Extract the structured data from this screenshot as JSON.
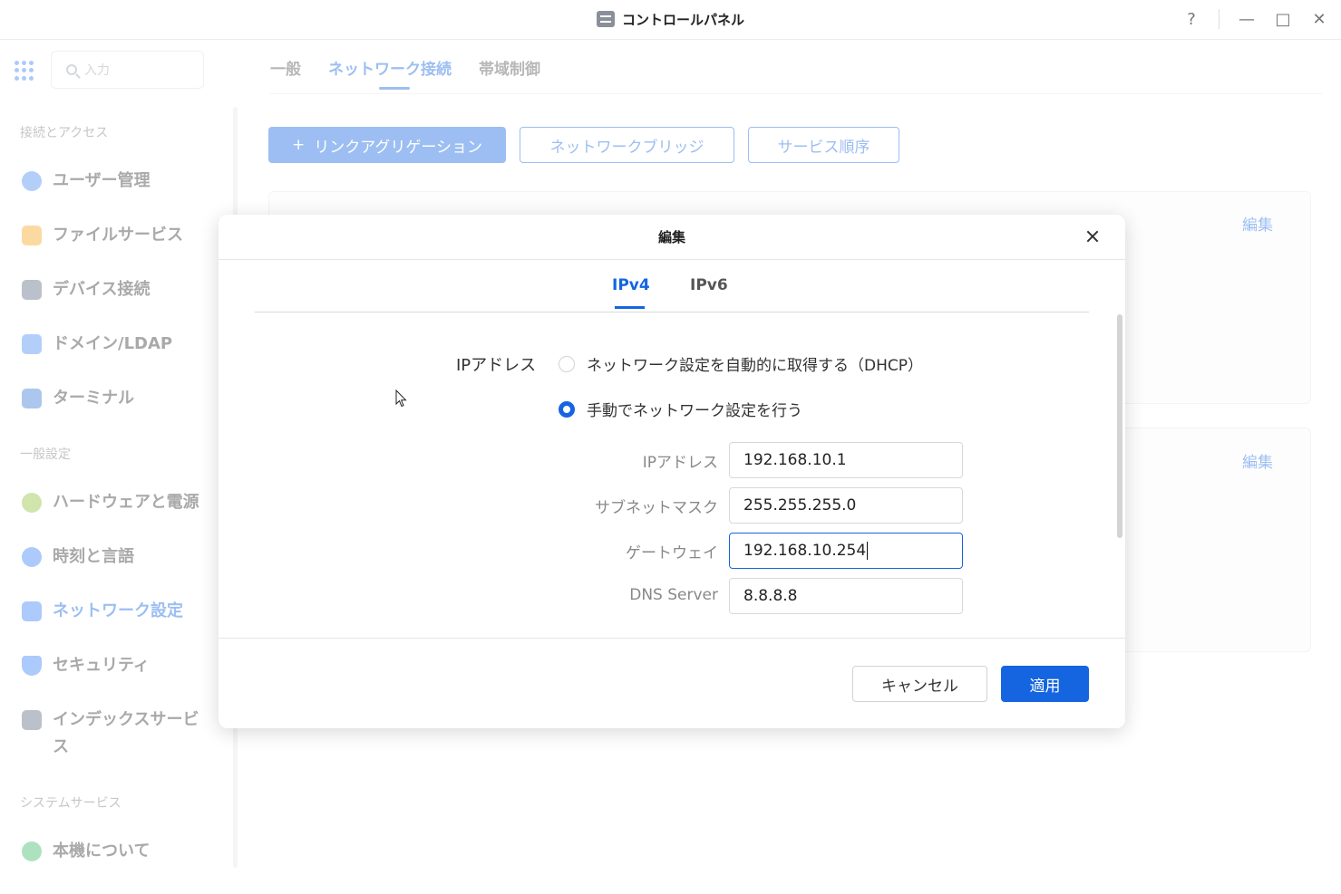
{
  "window": {
    "title": "コントロールパネル",
    "help": "?",
    "minimize": "—",
    "maximize": "□",
    "close": "✕"
  },
  "sidebar": {
    "search_placeholder": "入力",
    "sections": [
      {
        "title": "接続とアクセス"
      },
      {
        "title": "一般設定"
      },
      {
        "title": "システムサービス"
      }
    ],
    "items": [
      {
        "label": "ユーザー管理",
        "icon": "user-icon",
        "color": "#4a8ef0"
      },
      {
        "label": "ファイルサービス",
        "icon": "folder-icon",
        "color": "#f5a623"
      },
      {
        "label": "デバイス接続",
        "icon": "device-icon",
        "color": "#5b6b82"
      },
      {
        "label": "ドメイン/LDAP",
        "icon": "domain-icon",
        "color": "#4a8ef0"
      },
      {
        "label": "ターミナル",
        "icon": "terminal-icon",
        "color": "#3a7bd5"
      },
      {
        "label": "ハードウェアと電源",
        "icon": "hardware-icon",
        "color": "#8fc23f"
      },
      {
        "label": "時刻と言語",
        "icon": "globe-icon",
        "color": "#3b82f6"
      },
      {
        "label": "ネットワーク設定",
        "icon": "network-icon",
        "color": "#3b82f6",
        "active": true
      },
      {
        "label": "セキュリティ",
        "icon": "shield-icon",
        "color": "#3b82f6"
      },
      {
        "label": "インデックスサービス",
        "icon": "index-icon",
        "color": "#5b6b82"
      },
      {
        "label": "本機について",
        "icon": "info-icon",
        "color": "#3dbb6a"
      }
    ]
  },
  "main": {
    "tabs": [
      {
        "label": "一般"
      },
      {
        "label": "ネットワーク接続",
        "active": true
      },
      {
        "label": "帯域制御"
      }
    ],
    "buttons": {
      "link_aggregation": "リンクアグリゲーション",
      "plus": "+",
      "network_bridge": "ネットワークブリッジ",
      "service_order": "サービス順序"
    },
    "cards": [
      {
        "edit": "編集"
      },
      {
        "edit": "編集"
      }
    ]
  },
  "dialog": {
    "title": "編集",
    "tabs": [
      {
        "label": "IPv4",
        "active": true
      },
      {
        "label": "IPv6"
      }
    ],
    "ip_label": "IPアドレス",
    "radio_dhcp": "ネットワーク設定を自動的に取得する（DHCP）",
    "radio_manual": "手動でネットワーク設定を行う",
    "selected": "manual",
    "fields": [
      {
        "label": "IPアドレス",
        "value": "192.168.10.1"
      },
      {
        "label": "サブネットマスク",
        "value": "255.255.255.0"
      },
      {
        "label": "ゲートウェイ",
        "value": "192.168.10.254"
      },
      {
        "label": "DNS Server",
        "value": "8.8.8.8"
      }
    ],
    "cancel": "キャンセル",
    "apply": "適用"
  },
  "colors": {
    "accent": "#1565e0"
  }
}
